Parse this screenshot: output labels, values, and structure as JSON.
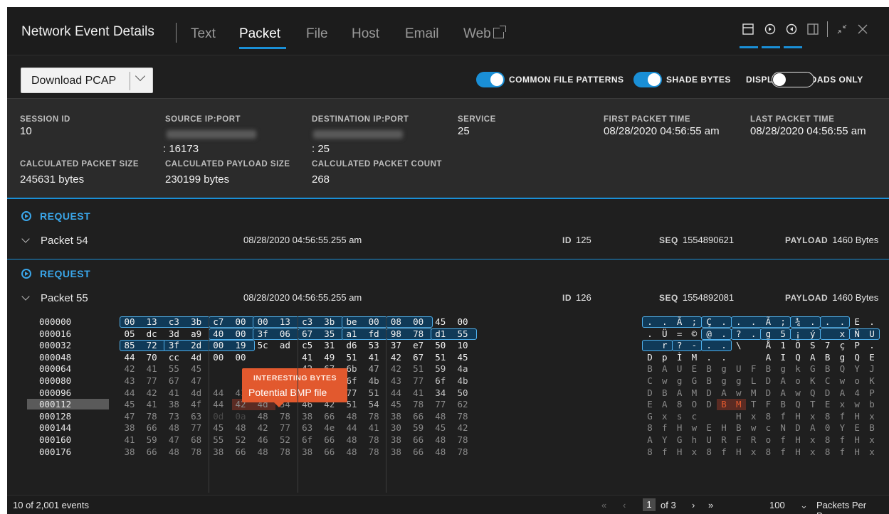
{
  "header": {
    "title": "Network Event Details",
    "tabs": [
      {
        "label": "Text",
        "active": false
      },
      {
        "label": "Packet",
        "active": true
      },
      {
        "label": "File",
        "active": false
      },
      {
        "label": "Host",
        "active": false
      },
      {
        "label": "Email",
        "active": false
      },
      {
        "label": "Web",
        "active": false
      }
    ],
    "window_icons": [
      "top-panel-icon",
      "arrow-right-circle-icon",
      "arrow-left-circle-icon",
      "side-panel-icon",
      "collapse-icon",
      "close-icon"
    ]
  },
  "toolbar": {
    "download_label": "Download PCAP",
    "toggles": [
      {
        "label": "COMMON FILE PATTERNS",
        "on": true
      },
      {
        "label": "SHADE BYTES",
        "on": true
      },
      {
        "label": "DISPLAY PAYLOADS ONLY",
        "on": false
      }
    ]
  },
  "meta": {
    "session_id_label": "SESSION ID",
    "session_id": "10",
    "source_label": "SOURCE IP:PORT",
    "source_port": ": 16173",
    "dest_label": "DESTINATION IP:PORT",
    "dest_port": ": 25",
    "service_label": "SERVICE",
    "service": "25",
    "first_time_label": "FIRST PACKET TIME",
    "first_time": "08/28/2020 04:56:55 am",
    "last_time_label": "LAST PACKET TIME",
    "last_time": "08/28/2020 04:56:55 am",
    "pkt_size_label": "CALCULATED PACKET SIZE",
    "pkt_size": "245631 bytes",
    "payload_size_label": "CALCULATED PAYLOAD SIZE",
    "payload_size": "230199 bytes",
    "pkt_count_label": "CALCULATED PACKET COUNT",
    "pkt_count": "268"
  },
  "packets": [
    {
      "heading": "REQUEST",
      "name": "Packet 54",
      "time": "08/28/2020 04:56:55.255 am",
      "id_label": "ID",
      "id": "125",
      "seq_label": "SEQ",
      "seq": "1554890621",
      "payload_label": "PAYLOAD",
      "payload": "1460 Bytes"
    },
    {
      "heading": "REQUEST",
      "name": "Packet 55",
      "time": "08/28/2020 04:56:55.255 am",
      "id_label": "ID",
      "id": "126",
      "seq_label": "SEQ",
      "seq": "1554892081",
      "payload_label": "PAYLOAD",
      "payload": "1460 Bytes"
    }
  ],
  "hex": {
    "offsets": [
      "000000",
      "000016",
      "000032",
      "000048",
      "000064",
      "000080",
      "000096",
      "000112",
      "000128",
      "000144",
      "000160",
      "000176"
    ],
    "selected_offset": "000112",
    "bytes": [
      [
        "00",
        "13",
        "c3",
        "3b",
        "c7",
        "00",
        "00",
        "13",
        "c3",
        "3b",
        "be",
        "00",
        "08",
        "00",
        "45",
        "00"
      ],
      [
        "05",
        "dc",
        "3d",
        "a9",
        "40",
        "00",
        "3f",
        "06",
        "67",
        "35",
        "a1",
        "fd",
        "98",
        "78",
        "d1",
        "55"
      ],
      [
        "85",
        "72",
        "3f",
        "2d",
        "00",
        "19",
        "5c",
        "ad",
        "c5",
        "31",
        "d6",
        "53",
        "37",
        "e7",
        "50",
        "10"
      ],
      [
        "44",
        "70",
        "cc",
        "4d",
        "00",
        "00",
        "",
        "",
        "41",
        "49",
        "51",
        "41",
        "42",
        "67",
        "51",
        "45"
      ],
      [
        "42",
        "41",
        "55",
        "45",
        "",
        "",
        "",
        "",
        "42",
        "67",
        "6b",
        "47",
        "42",
        "51",
        "59",
        "4a"
      ],
      [
        "43",
        "77",
        "67",
        "47",
        "",
        "",
        "",
        "",
        "44",
        "41",
        "6f",
        "4b",
        "43",
        "77",
        "6f",
        "4b"
      ],
      [
        "44",
        "42",
        "41",
        "4d",
        "44",
        "41",
        "77",
        "4d",
        "44",
        "41",
        "77",
        "51",
        "44",
        "41",
        "34",
        "50"
      ],
      [
        "45",
        "41",
        "38",
        "4f",
        "44",
        "42",
        "4d",
        "54",
        "46",
        "42",
        "51",
        "54",
        "45",
        "78",
        "77",
        "62"
      ],
      [
        "47",
        "78",
        "73",
        "63",
        "0d",
        "0a",
        "48",
        "78",
        "38",
        "66",
        "48",
        "78",
        "38",
        "66",
        "48",
        "78"
      ],
      [
        "38",
        "66",
        "48",
        "77",
        "45",
        "48",
        "42",
        "77",
        "63",
        "4e",
        "44",
        "41",
        "30",
        "59",
        "45",
        "42"
      ],
      [
        "41",
        "59",
        "47",
        "68",
        "55",
        "52",
        "46",
        "52",
        "6f",
        "66",
        "48",
        "78",
        "38",
        "66",
        "48",
        "78"
      ],
      [
        "38",
        "66",
        "48",
        "78",
        "38",
        "66",
        "48",
        "78",
        "38",
        "66",
        "48",
        "78",
        "38",
        "66",
        "48",
        "78"
      ]
    ],
    "ascii": [
      [
        ".",
        ".",
        "Ã",
        ";",
        "Ç",
        ".",
        ".",
        ".",
        "Ã",
        ";",
        "¾",
        ".",
        ".",
        ".",
        "E",
        "."
      ],
      [
        ".",
        "Ü",
        "=",
        "©",
        "@",
        ".",
        "?",
        ".",
        "g",
        "5",
        "¡",
        "ý",
        "",
        "x",
        "Ñ",
        "U"
      ],
      [
        "",
        "r",
        "?",
        "-",
        ".",
        ".",
        "\\",
        "",
        "Å",
        "1",
        "Ö",
        "S",
        "7",
        "ç",
        "P",
        "."
      ],
      [
        "D",
        "p",
        "Ì",
        "M",
        ".",
        ".",
        "",
        "",
        "A",
        "I",
        "Q",
        "A",
        "B",
        "g",
        "Q",
        "E"
      ],
      [
        "B",
        "A",
        "U",
        "E",
        "B",
        "g",
        "U",
        "F",
        "B",
        "g",
        "k",
        "G",
        "B",
        "Q",
        "Y",
        "J"
      ],
      [
        "C",
        "w",
        "g",
        "G",
        "B",
        "g",
        "g",
        "L",
        "D",
        "A",
        "o",
        "K",
        "C",
        "w",
        "o",
        "K"
      ],
      [
        "D",
        "B",
        "A",
        "M",
        "D",
        "A",
        "w",
        "M",
        "D",
        "A",
        "w",
        "Q",
        "D",
        "A",
        "4",
        "P"
      ],
      [
        "E",
        "A",
        "8",
        "O",
        "D",
        "B",
        "M",
        "T",
        "F",
        "B",
        "Q",
        "T",
        "E",
        "x",
        "w",
        "b"
      ],
      [
        "G",
        "x",
        "s",
        "c",
        "",
        "",
        "H",
        "x",
        "8",
        "f",
        "H",
        "x",
        "8",
        "f",
        "H",
        "x"
      ],
      [
        "8",
        "f",
        "H",
        "w",
        "E",
        "H",
        "B",
        "w",
        "c",
        "N",
        "D",
        "A",
        "0",
        "Y",
        "E",
        "B"
      ],
      [
        "A",
        "Y",
        "G",
        "h",
        "U",
        "R",
        "F",
        "R",
        "o",
        "f",
        "H",
        "x",
        "8",
        "f",
        "H",
        "x"
      ],
      [
        "8",
        "f",
        "H",
        "x",
        "8",
        "f",
        "H",
        "x",
        "8",
        "f",
        "H",
        "x",
        "8",
        "f",
        "H",
        "x"
      ]
    ],
    "tooltip_title": "INTERESTING BYTES",
    "tooltip_text": "Potential BMP file"
  },
  "footer": {
    "events": "10 of 2,001 events",
    "page": "1",
    "of_pages": "of 3",
    "per_page": "100",
    "per_page_label": "Packets Per Page"
  },
  "colors": {
    "accent": "#1a8fd6",
    "highlight": "#e2592e",
    "background": "#1f1f1f"
  }
}
